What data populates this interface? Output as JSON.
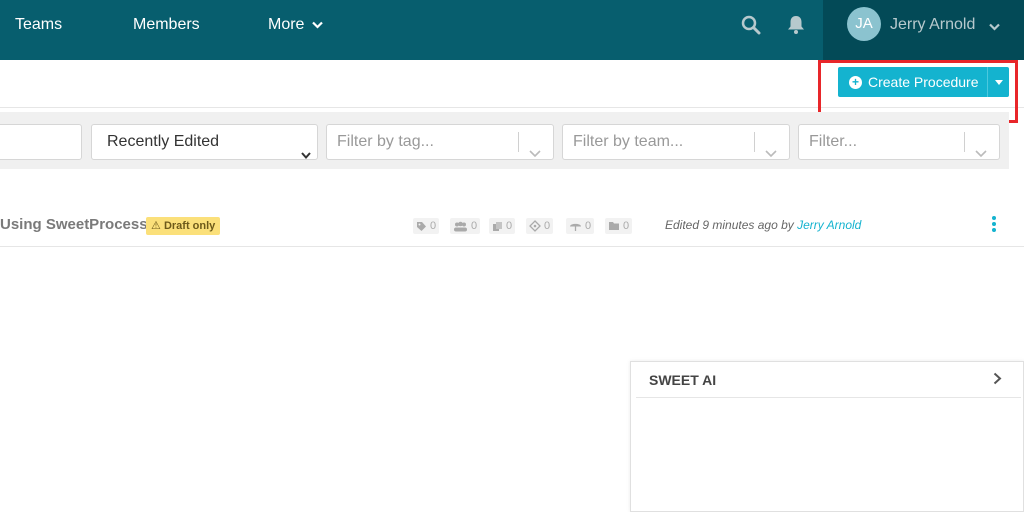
{
  "nav": {
    "teams": "Teams",
    "members": "Members",
    "more": "More",
    "user_initials": "JA",
    "user_name": "Jerry Arnold",
    "icons": [
      "search-icon",
      "bell-icon",
      "chevron-down-icon"
    ]
  },
  "actions": {
    "create_label": "Create Procedure"
  },
  "filters": {
    "sort_value": "Recently Edited",
    "tag_placeholder": "Filter by tag...",
    "team_placeholder": "Filter by team...",
    "filter_placeholder": "Filter..."
  },
  "row": {
    "title": "Using SweetProcess",
    "badge": "Draft only",
    "stats": {
      "tags": "0",
      "members": "0",
      "copies": "0",
      "approvals": "0",
      "reviews": "0",
      "folders": "0"
    },
    "edited_prefix": "Edited 9 minutes ago by ",
    "edited_author": "Jerry Arnold"
  },
  "ai_panel": {
    "title": "SWEET AI"
  },
  "colors": {
    "nav_bg": "#075e6e",
    "user_bg": "#034a57",
    "accent": "#14b3cf",
    "highlight": "#e8262a",
    "badge": "#fbe07a"
  }
}
